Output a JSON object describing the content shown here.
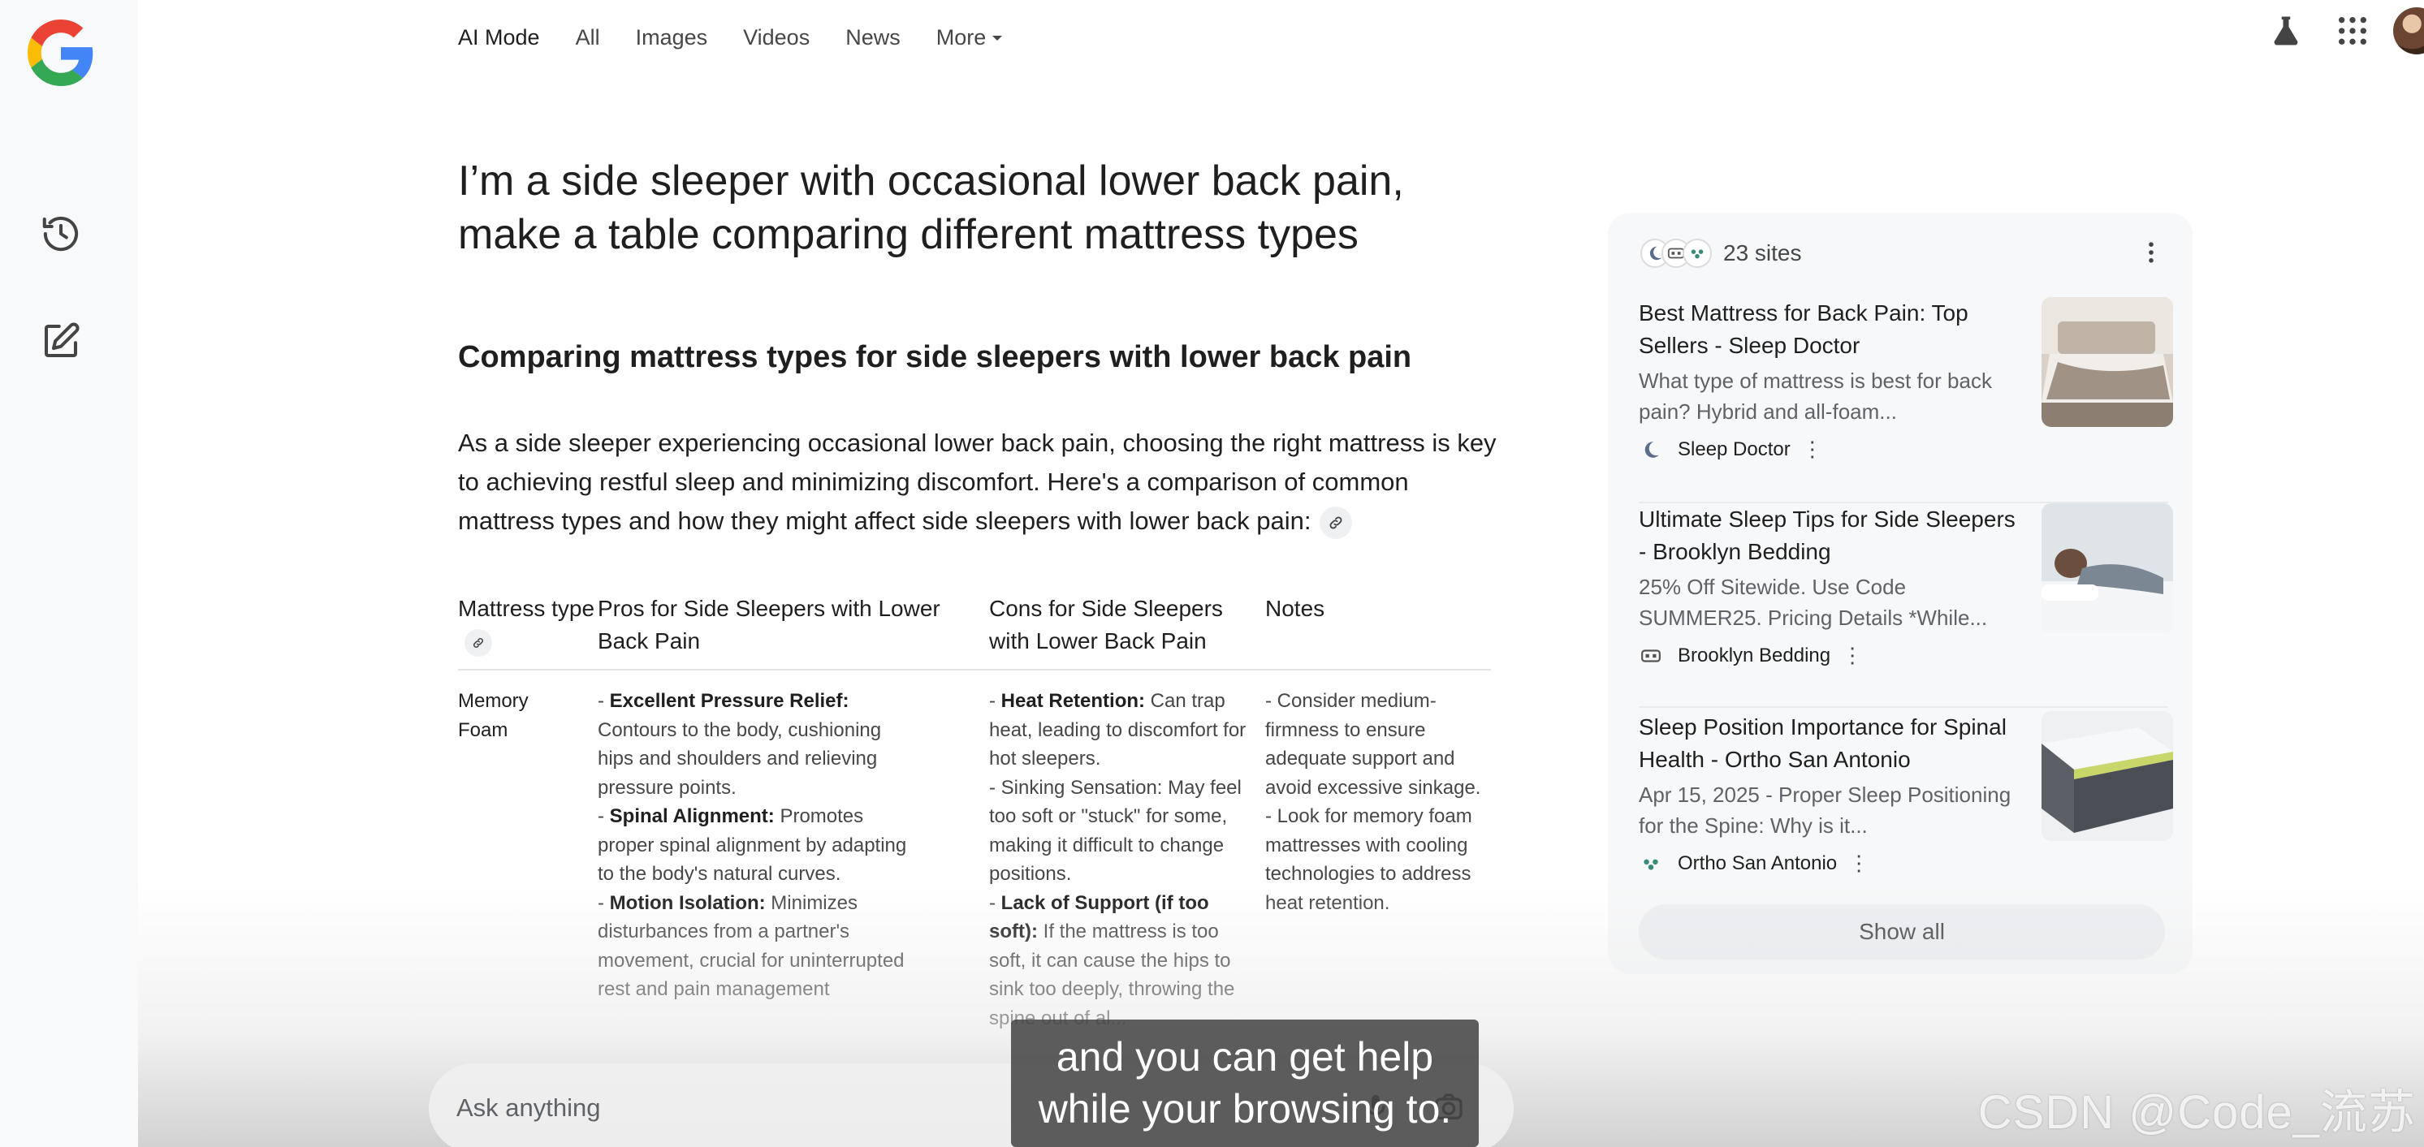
{
  "nav": {
    "tabs": [
      {
        "label": "AI Mode",
        "active": true
      },
      {
        "label": "All"
      },
      {
        "label": "Images"
      },
      {
        "label": "Videos"
      },
      {
        "label": "News"
      }
    ],
    "more_label": "More"
  },
  "rail": {
    "items": [
      "history-icon",
      "new-chat-icon"
    ]
  },
  "topright": {
    "icons": [
      "labs-flask-icon",
      "apps-grid-icon",
      "account-avatar"
    ]
  },
  "query": "I’m a side sleeper with occasional lower back pain, make a table comparing different mattress types",
  "answer": {
    "heading": "Comparing mattress types for side sleepers with lower back pain",
    "intro": "As a side sleeper experiencing occasional lower back pain, choosing the right mattress is key to achieving restful sleep and minimizing discomfort. Here's a comparison of common mattress types and how they might affect side sleepers with lower back pain:",
    "table": {
      "headers": [
        "Mattress type",
        "Pros for Side Sleepers with Lower Back Pain",
        "Cons for Side Sleepers with Lower Back Pain",
        "Notes"
      ],
      "row": {
        "type": "Memory Foam",
        "pros": [
          {
            "bold": "Excellent Pressure Relief:",
            "text": " Contours to the body, cushioning hips and shoulders and relieving pressure points."
          },
          {
            "bold": "Spinal Alignment:",
            "text": " Promotes proper spinal alignment by adapting to the body's natural curves."
          },
          {
            "bold": "Motion Isolation:",
            "text": " Minimizes disturbances from a partner's movement, crucial for uninterrupted rest and pain management"
          }
        ],
        "cons": [
          {
            "bold": "Heat Retention:",
            "text": " Can trap heat, leading to discomfort for hot sleepers."
          },
          {
            "bold": "",
            "text": "Sinking Sensation: May feel too soft or \"stuck\" for some, making it difficult to change positions."
          },
          {
            "bold": "Lack of Support (if too soft):",
            "text": " If the mattress is too soft, it can cause the hips to sink too deeply, throwing the spine out of al..."
          }
        ],
        "notes": [
          "- Consider medium-firmness to ensure adequate support and avoid excessive sinkage.",
          "- Look for memory foam mattresses with cooling technologies to address heat retention."
        ]
      }
    }
  },
  "ask": {
    "placeholder": "Ask anything"
  },
  "sources": {
    "count_label": "23 sites",
    "cards": [
      {
        "title": "Best Mattress for Back Pain: Top Sellers - Sleep Doctor",
        "snippet": "What type of mattress is best for back pain? Hybrid and all-foam...",
        "source": "Sleep Doctor",
        "thumb_colors": [
          "#cfc6bb",
          "#8c7f72"
        ]
      },
      {
        "title": "Ultimate Sleep Tips for Side Sleepers - Brooklyn Bedding",
        "snippet": "25% Off Sitewide. Use Code SUMMER25. Pricing Details *While...",
        "source": "Brooklyn Bedding",
        "thumb_colors": [
          "#d7dde2",
          "#7b8793"
        ]
      },
      {
        "title": "Sleep Position Importance for Spinal Health - Ortho San Antonio",
        "snippet": "Apr 15, 2025 - Proper Sleep Positioning for the Spine: Why is it...",
        "source": "Ortho San Antonio",
        "thumb_colors": [
          "#e9ecef",
          "#4a4f55"
        ]
      }
    ],
    "show_all_label": "Show all"
  },
  "overlay": {
    "subtitle_line1": "and you can get help",
    "subtitle_line2": "while your browsing to.",
    "watermark": "CSDN @Code_流苏"
  }
}
